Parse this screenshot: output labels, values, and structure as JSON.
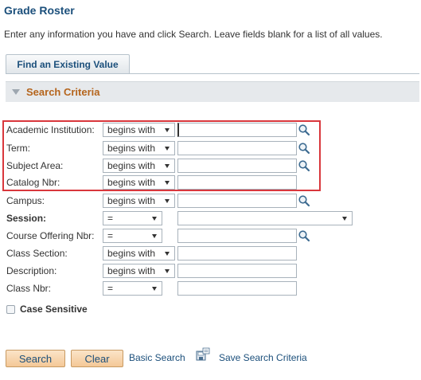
{
  "header": {
    "title": "Grade Roster",
    "instructions": "Enter any information you have and click Search. Leave fields blank for a list of all values."
  },
  "tabs": {
    "find_existing": "Find an Existing Value"
  },
  "section": {
    "title": "Search Criteria"
  },
  "fields": {
    "academic_institution": {
      "label": "Academic Institution:",
      "operator": "begins with",
      "value": ""
    },
    "term": {
      "label": "Term:",
      "operator": "begins with",
      "value": ""
    },
    "subject_area": {
      "label": "Subject Area:",
      "operator": "begins with",
      "value": ""
    },
    "catalog_nbr": {
      "label": "Catalog Nbr:",
      "operator": "begins with",
      "value": ""
    },
    "campus": {
      "label": "Campus:",
      "operator": "begins with",
      "value": ""
    },
    "session": {
      "label": "Session:",
      "operator": "=",
      "value": ""
    },
    "course_offering_nbr": {
      "label": "Course Offering Nbr:",
      "operator": "=",
      "value": ""
    },
    "class_section": {
      "label": "Class Section:",
      "operator": "begins with",
      "value": ""
    },
    "description": {
      "label": "Description:",
      "operator": "begins with",
      "value": ""
    },
    "class_nbr": {
      "label": "Class Nbr:",
      "operator": "=",
      "value": ""
    }
  },
  "case_sensitive": {
    "label": "Case Sensitive",
    "checked": false
  },
  "actions": {
    "search": "Search",
    "clear": "Clear",
    "basic_search": "Basic Search",
    "save_search": "Save Search Criteria"
  },
  "colors": {
    "title": "#1b4f7b",
    "section_title": "#b5651d",
    "highlight": "#d9373c",
    "button_bg": "#f4c897"
  },
  "icons": {
    "lookup": "magnifier-icon",
    "save": "save-search-icon",
    "collapse": "triangle-down-icon"
  }
}
